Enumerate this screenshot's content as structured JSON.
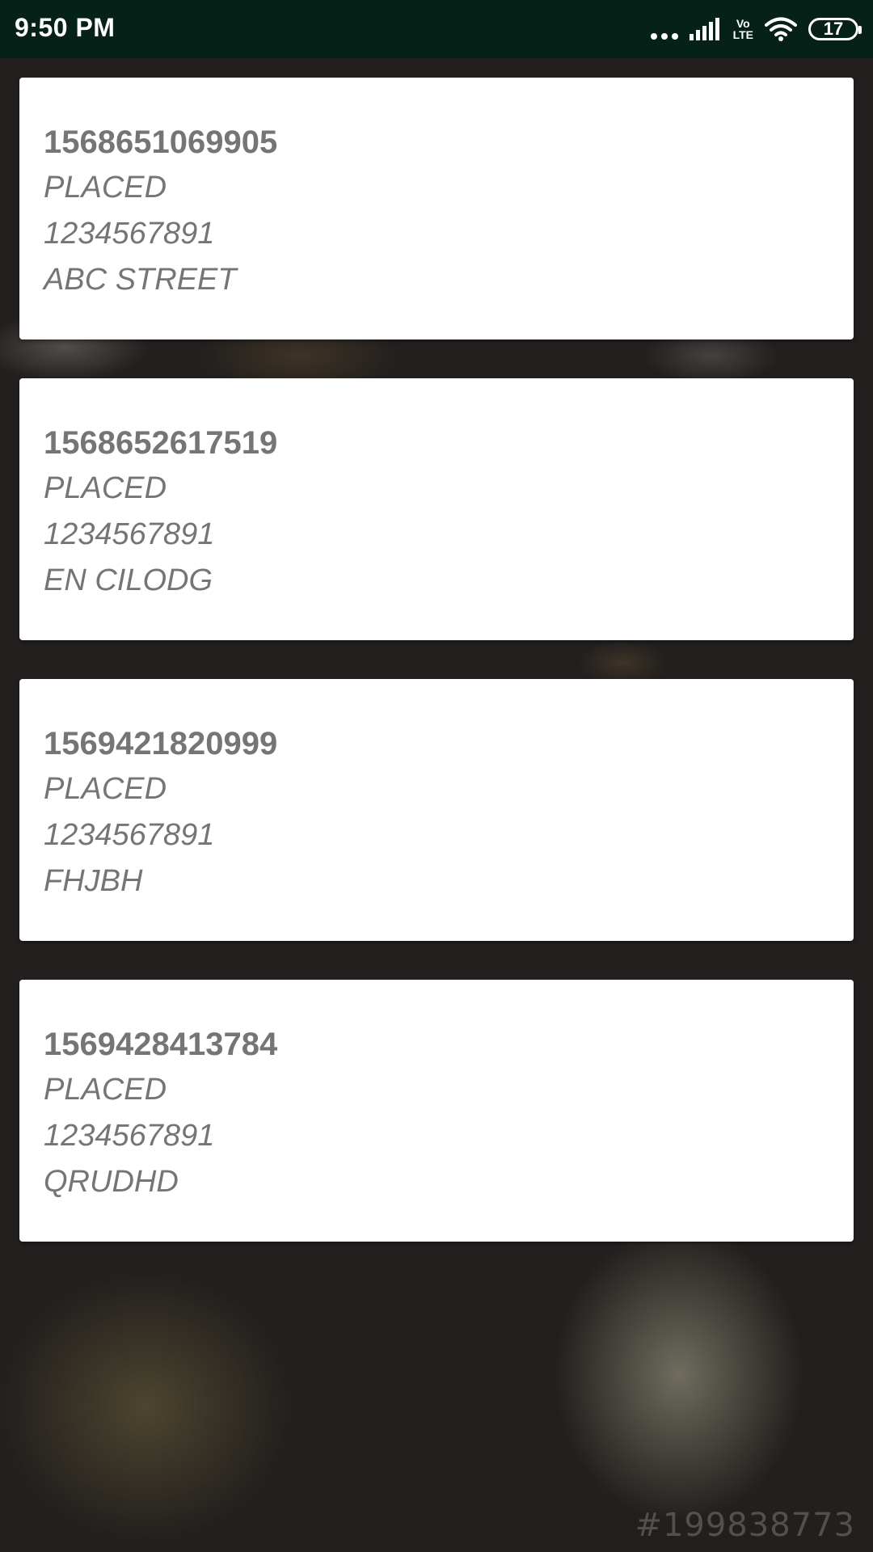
{
  "status_bar": {
    "time": "9:50 PM",
    "network_label_top": "Vo",
    "network_label_bottom": "LTE",
    "battery_level": "17"
  },
  "orders": [
    {
      "id": "1568651069905",
      "status": "PLACED",
      "phone": "1234567891",
      "address": "ABC STREET"
    },
    {
      "id": "1568652617519",
      "status": "PLACED",
      "phone": "1234567891",
      "address": "EN CILODG"
    },
    {
      "id": "1569421820999",
      "status": "PLACED",
      "phone": "1234567891",
      "address": "FHJBH"
    },
    {
      "id": "1569428413784",
      "status": "PLACED",
      "phone": "1234567891",
      "address": "QRUDHD"
    }
  ],
  "background": {
    "watermark": "#199838773"
  },
  "colors": {
    "status_bar_bg": "#062118",
    "card_bg": "#ffffff",
    "card_text": "#757575"
  }
}
